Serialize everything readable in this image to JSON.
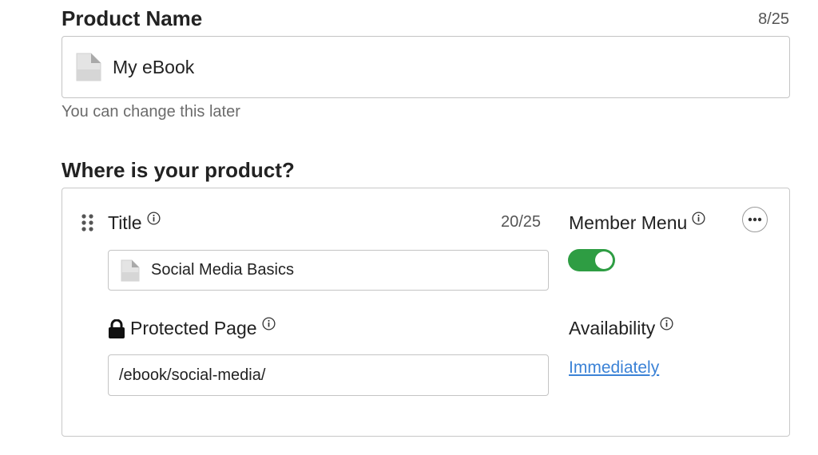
{
  "product_name": {
    "title": "Product Name",
    "counter": "8/25",
    "value": "My eBook",
    "helper": "You can change this later"
  },
  "location": {
    "title": "Where is your product?",
    "item": {
      "title_label": "Title",
      "title_counter": "20/25",
      "title_value": "Social Media Basics",
      "member_menu_label": "Member Menu",
      "member_menu_enabled": true,
      "protected_page_label": "Protected Page",
      "protected_page_value": "/ebook/social-media/",
      "availability_label": "Availability",
      "availability_value": "Immediately"
    }
  },
  "colors": {
    "toggle_on": "#2e9d43",
    "link": "#3b82d6",
    "border": "#c4c4c4"
  },
  "icons": {
    "document": "document-icon",
    "info": "info-icon",
    "lock": "lock-icon",
    "drag": "drag-handle-icon",
    "more": "more-options-icon"
  }
}
